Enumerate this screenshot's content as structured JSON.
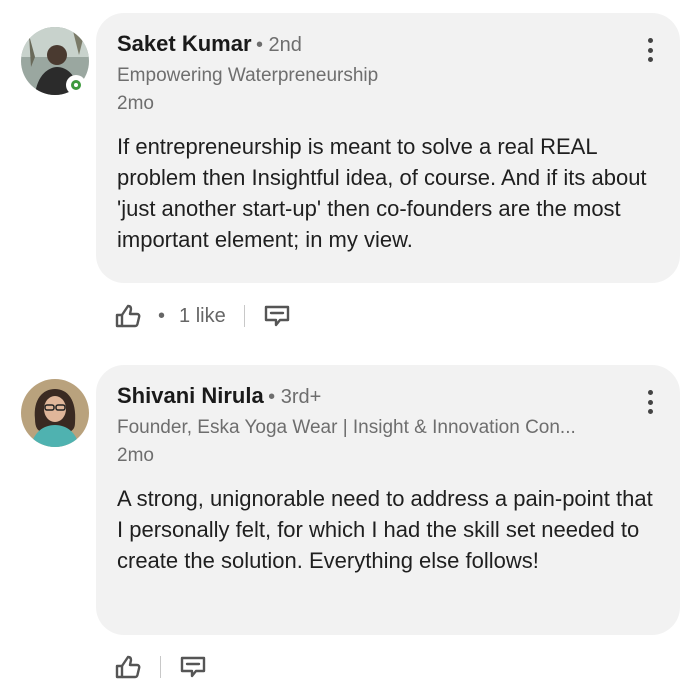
{
  "comments": [
    {
      "name": "Saket Kumar",
      "degree": "• 2nd",
      "headline": "Empowering Waterpreneurship",
      "time": "2mo",
      "text": "If entrepreneurship is meant to solve a real REAL problem then Insightful idea, of course. And if its about 'just another start-up' then co-founders are the most important element; in my view.",
      "reactions_dot": "•",
      "likes": "1 like",
      "online": true
    },
    {
      "name": "Shivani Nirula",
      "degree": "• 3rd+",
      "headline": "Founder, Eska Yoga Wear | Insight & Innovation Con...",
      "time": "2mo",
      "text": "A strong, unignorable need to address a pain-point that I personally felt, for which I had the skill set needed to create the solution. Everything else follows!"
    }
  ],
  "icons": {
    "like": "thumbs-up-icon",
    "reply": "reply-icon",
    "more": "more-vertical-icon"
  },
  "colors": {
    "bubble": "#f2f2f2",
    "meta_text": "#6e6e6e",
    "online": "#3c9a3c"
  }
}
